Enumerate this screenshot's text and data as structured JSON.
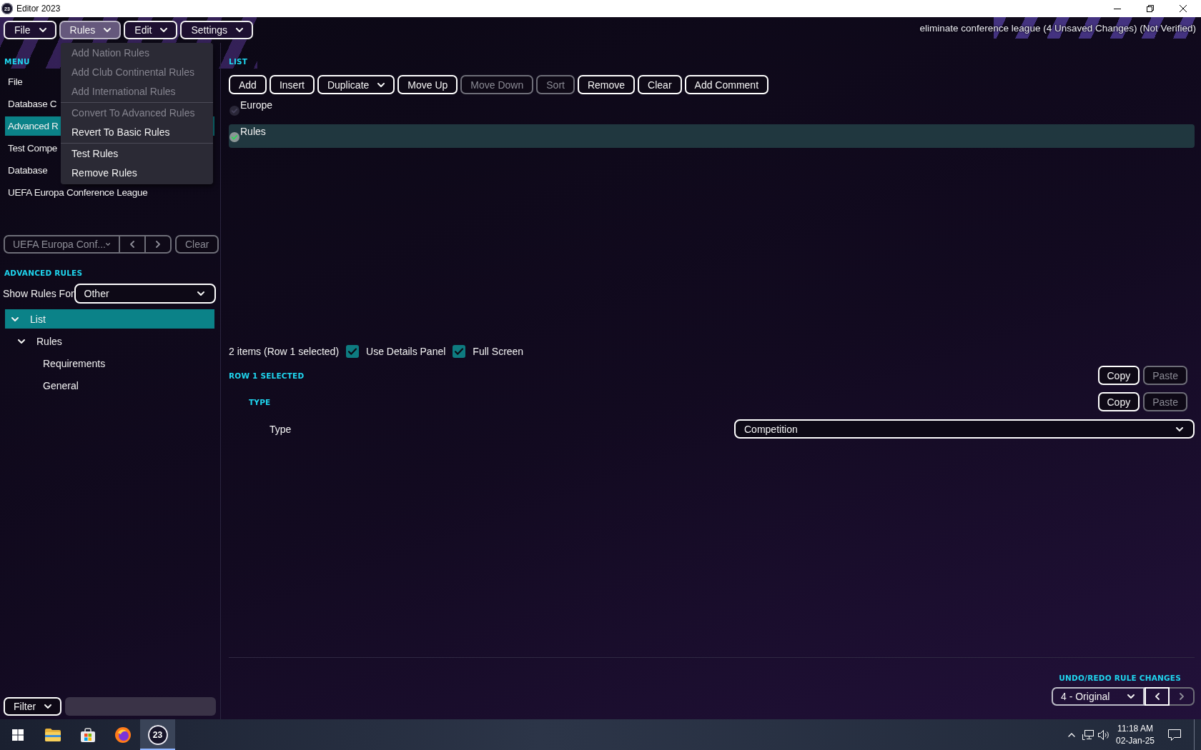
{
  "window": {
    "icon_text": "23",
    "title": "Editor 2023"
  },
  "menu_bar": [
    {
      "label": "File",
      "open": false
    },
    {
      "label": "Rules",
      "open": true
    },
    {
      "label": "Edit",
      "open": false
    },
    {
      "label": "Settings",
      "open": false
    }
  ],
  "document_title": "eliminate conference league (4 Unsaved Changes) (Not Verified)",
  "open_menu": [
    {
      "kind": "item",
      "label": "Add Nation Rules",
      "disabled": true
    },
    {
      "kind": "item",
      "label": "Add Club Continental Rules",
      "disabled": true
    },
    {
      "kind": "item",
      "label": "Add International Rules",
      "disabled": true
    },
    {
      "kind": "separator"
    },
    {
      "kind": "item",
      "label": "Convert To Advanced Rules",
      "disabled": true
    },
    {
      "kind": "item",
      "label": "Revert To Basic Rules",
      "disabled": false
    },
    {
      "kind": "separator"
    },
    {
      "kind": "item",
      "label": "Test Rules",
      "disabled": false
    },
    {
      "kind": "item",
      "label": "Remove Rules",
      "disabled": false
    }
  ],
  "sidebar": {
    "heading": "MENU",
    "items": [
      {
        "label": "File",
        "selected": false
      },
      {
        "label": "Database C",
        "selected": false
      },
      {
        "label": "Advanced R",
        "selected": true
      },
      {
        "label": "Test Compe",
        "selected": false
      },
      {
        "label": "Database",
        "selected": false
      },
      {
        "label": "UEFA Europa Conference League",
        "selected": false
      }
    ],
    "navigator": {
      "value": "UEFA Europa Conf...",
      "disabled": true,
      "buttons": [
        {
          "kind": "previous",
          "disabled": true
        },
        {
          "kind": "next",
          "disabled": true
        }
      ],
      "clear": {
        "label": "Clear",
        "disabled": true
      }
    }
  },
  "advanced_rules": {
    "heading": "ADVANCED RULES",
    "show_rules_for": {
      "label": "Show Rules For",
      "value": "Other"
    },
    "tree": [
      {
        "label": "List",
        "selected": true,
        "expanded": true,
        "children": [
          {
            "label": "Rules",
            "selected": false,
            "expanded": true,
            "children": [
              {
                "label": "Requirements",
                "selected": false
              },
              {
                "label": "General",
                "selected": false
              }
            ]
          }
        ]
      }
    ]
  },
  "filter": {
    "label": "Filter"
  },
  "list": {
    "heading": "LIST",
    "toolbar": [
      {
        "kind": "button",
        "label": "Add",
        "disabled": false
      },
      {
        "kind": "button",
        "label": "Insert",
        "disabled": false
      },
      {
        "kind": "dropdown",
        "label": "Duplicate",
        "disabled": false
      },
      {
        "kind": "button",
        "label": "Move Up",
        "disabled": false
      },
      {
        "kind": "button",
        "label": "Move Down",
        "disabled": true
      },
      {
        "kind": "button",
        "label": "Sort",
        "disabled": true
      },
      {
        "kind": "button",
        "label": "Remove",
        "disabled": false
      },
      {
        "kind": "button",
        "label": "Clear",
        "disabled": false
      },
      {
        "kind": "button",
        "label": "Add Comment",
        "disabled": false
      }
    ],
    "rows": [
      {
        "label": "Europe",
        "selected": false,
        "checked": false
      },
      {
        "label": "Rules",
        "selected": true,
        "checked": true
      }
    ],
    "summary": "2 items (Row 1 selected)",
    "options": [
      {
        "label": "Use Details Panel",
        "checked": true
      },
      {
        "label": "Full Screen",
        "checked": true
      }
    ]
  },
  "details": {
    "heading": "ROW 1 SELECTED",
    "actions": [
      {
        "label": "Copy",
        "disabled": false
      },
      {
        "label": "Paste",
        "disabled": true
      }
    ],
    "sections": [
      {
        "heading": "TYPE",
        "actions": [
          {
            "label": "Copy",
            "disabled": false
          },
          {
            "label": "Paste",
            "disabled": true
          }
        ],
        "fields": [
          {
            "label": "Type",
            "value": "Competition"
          }
        ]
      }
    ]
  },
  "undo_redo": {
    "heading": "UNDO/REDO RULE CHANGES",
    "value": "4 - Original",
    "buttons": [
      {
        "kind": "back",
        "disabled": false
      },
      {
        "kind": "forward",
        "disabled": true
      }
    ]
  },
  "taskbar": {
    "apps": [
      {
        "kind": "start",
        "active": false
      },
      {
        "kind": "folder",
        "active": false
      },
      {
        "kind": "store",
        "active": false
      },
      {
        "kind": "browser",
        "active": false
      },
      {
        "kind": "editor",
        "active": true,
        "icon_text": "23"
      }
    ],
    "tray": {
      "time": "11:18 AM",
      "date": "02-Jan-25"
    }
  }
}
